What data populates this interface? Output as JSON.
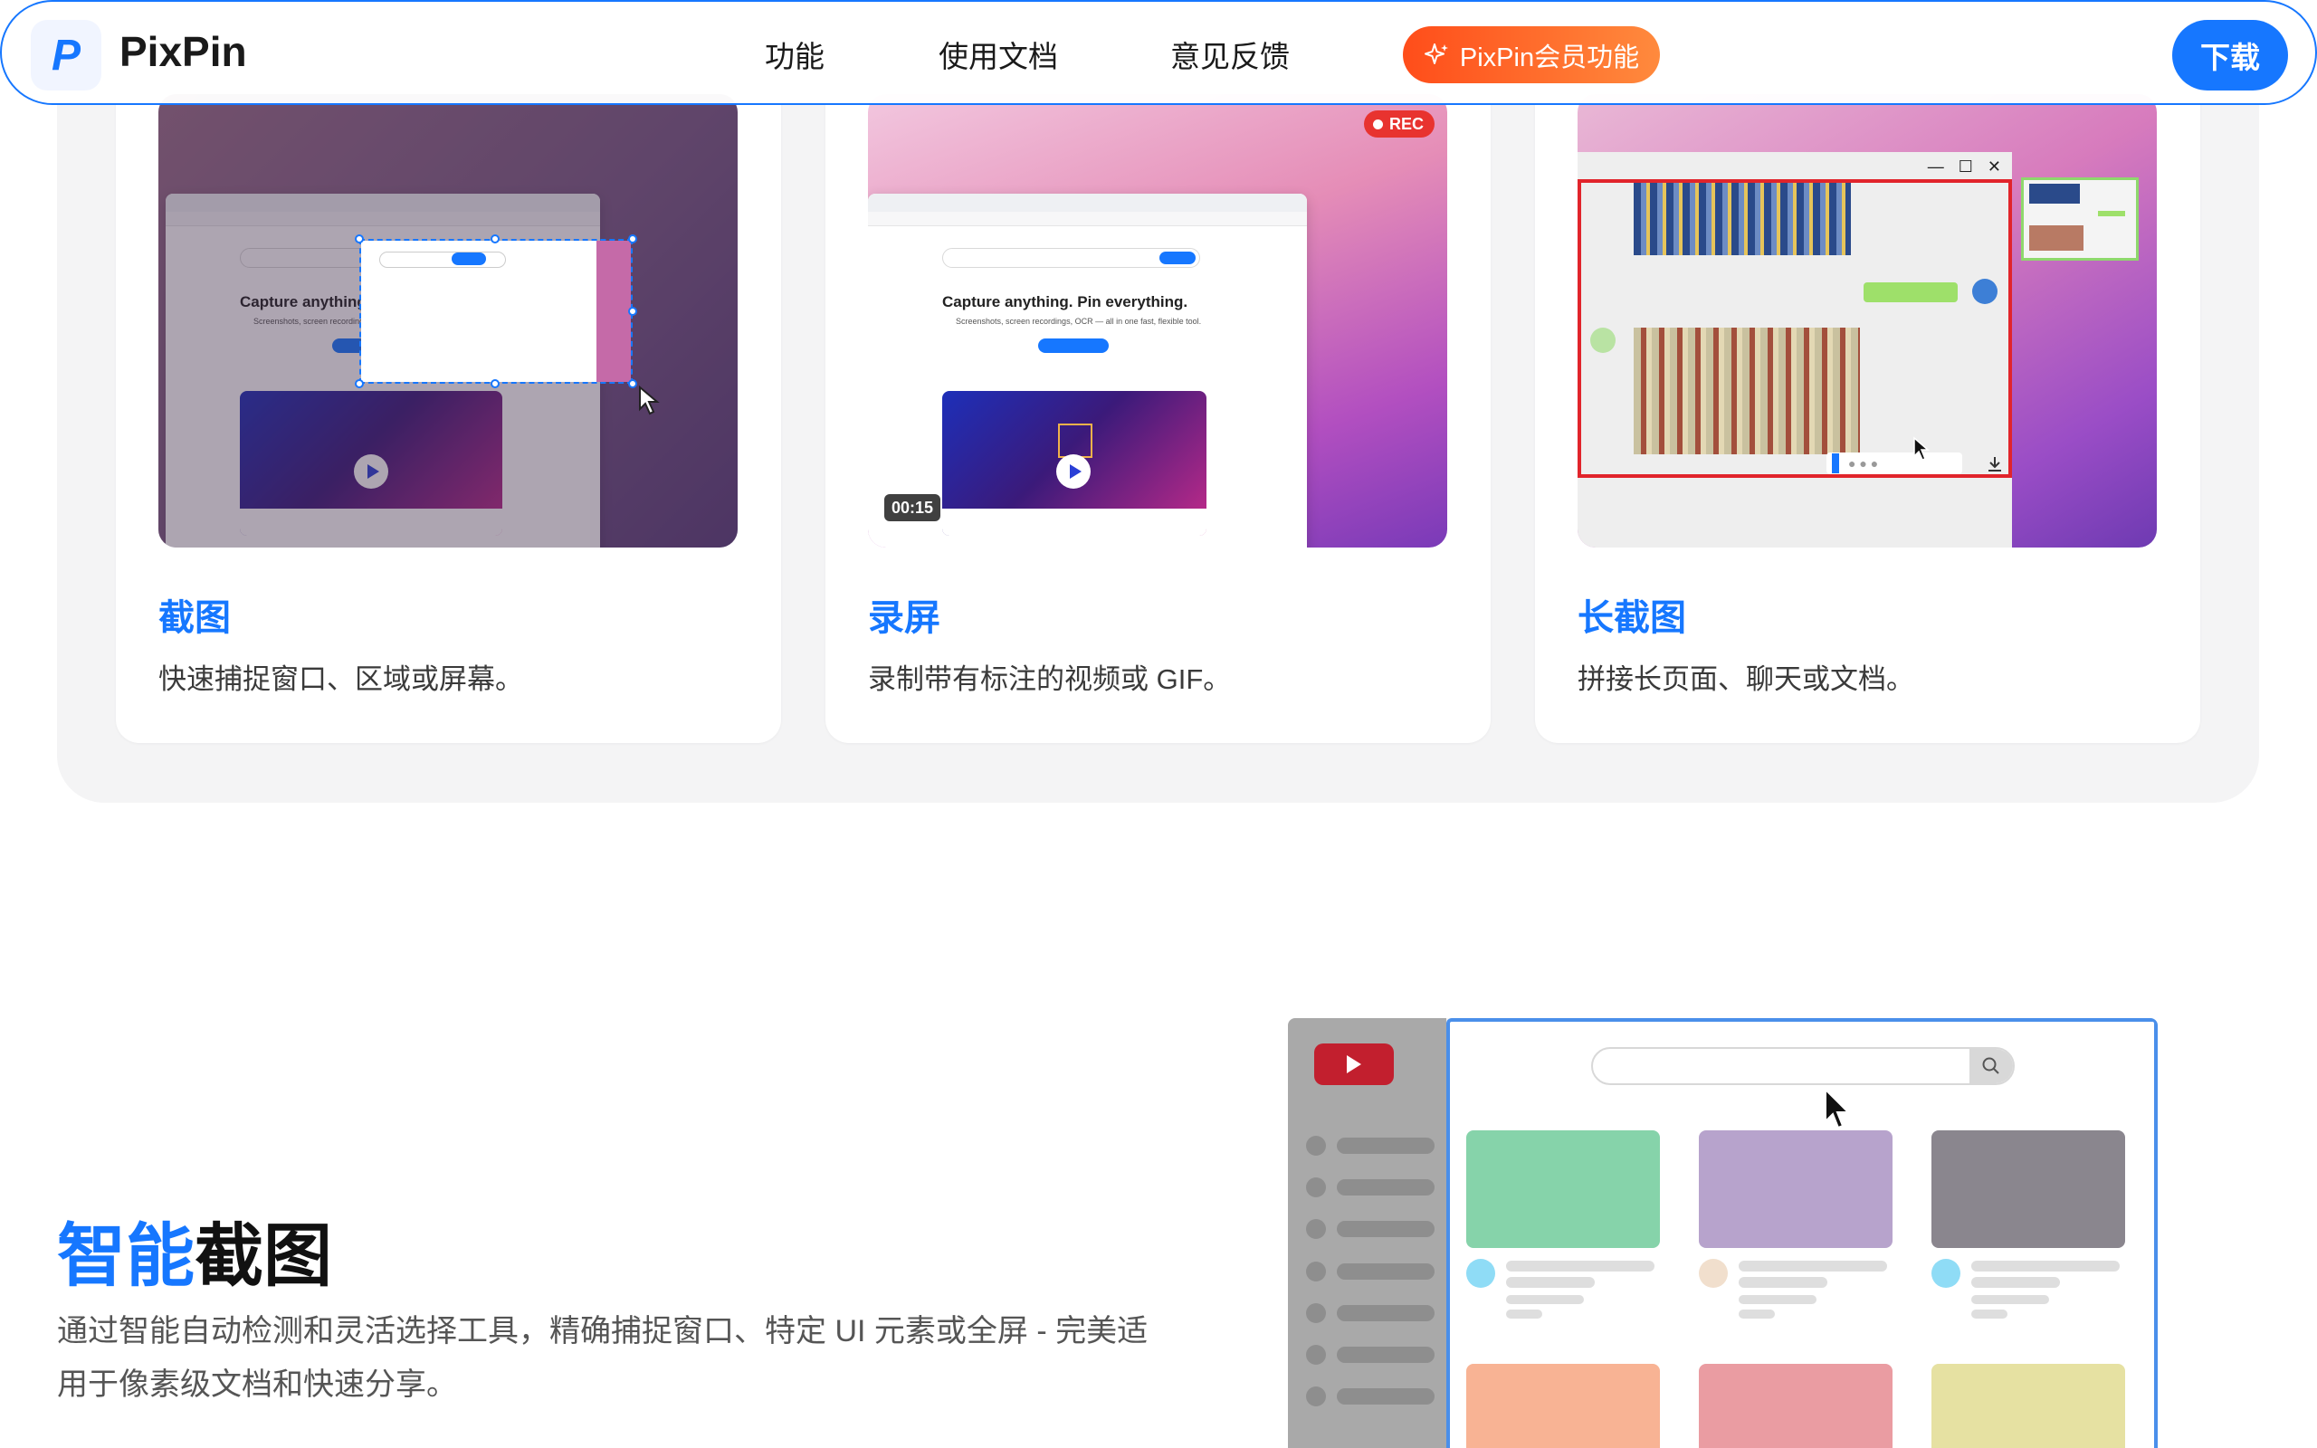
{
  "navbar": {
    "brand": "PixPin",
    "logo_letter": "P",
    "links": [
      "功能",
      "使用文档",
      "意见反馈"
    ],
    "vip_label": "PixPin会员功能",
    "download_label": "下载"
  },
  "cards": [
    {
      "title": "截图",
      "desc": "快速捕捉窗口、区域或屏幕。",
      "mini_title": "Capture anything. Pin everything.",
      "mini_sub": "Screenshots, screen recordings, OCR — all in one fast, flexible tool."
    },
    {
      "title": "录屏",
      "desc": "录制带有标注的视频或 GIF。",
      "rec_badge": "REC",
      "timer": "00:15",
      "mini_title": "Capture anything. Pin everything.",
      "mini_sub": "Screenshots, screen recordings, OCR — all in one fast, flexible tool."
    },
    {
      "title": "长截图",
      "desc": "拼接长页面、聊天或文档。"
    }
  ],
  "smart": {
    "title_highlight": "智能",
    "title_rest": "截图",
    "desc": "通过智能自动检测和灵活选择工具，精确捕捉窗口、特定 UI 元素或全屏 - 完美适用于像素级文档和快速分享。"
  },
  "colors": {
    "accent": "#1677ff",
    "vip_start": "#ff4d1a",
    "vip_end": "#ff8a3d",
    "section_bg": "#f4f4f5"
  },
  "icons": [
    "sparkle-icon",
    "play-icon",
    "search-icon",
    "cursor-icon",
    "minimize-icon",
    "maximize-icon",
    "close-icon",
    "download-icon"
  ]
}
